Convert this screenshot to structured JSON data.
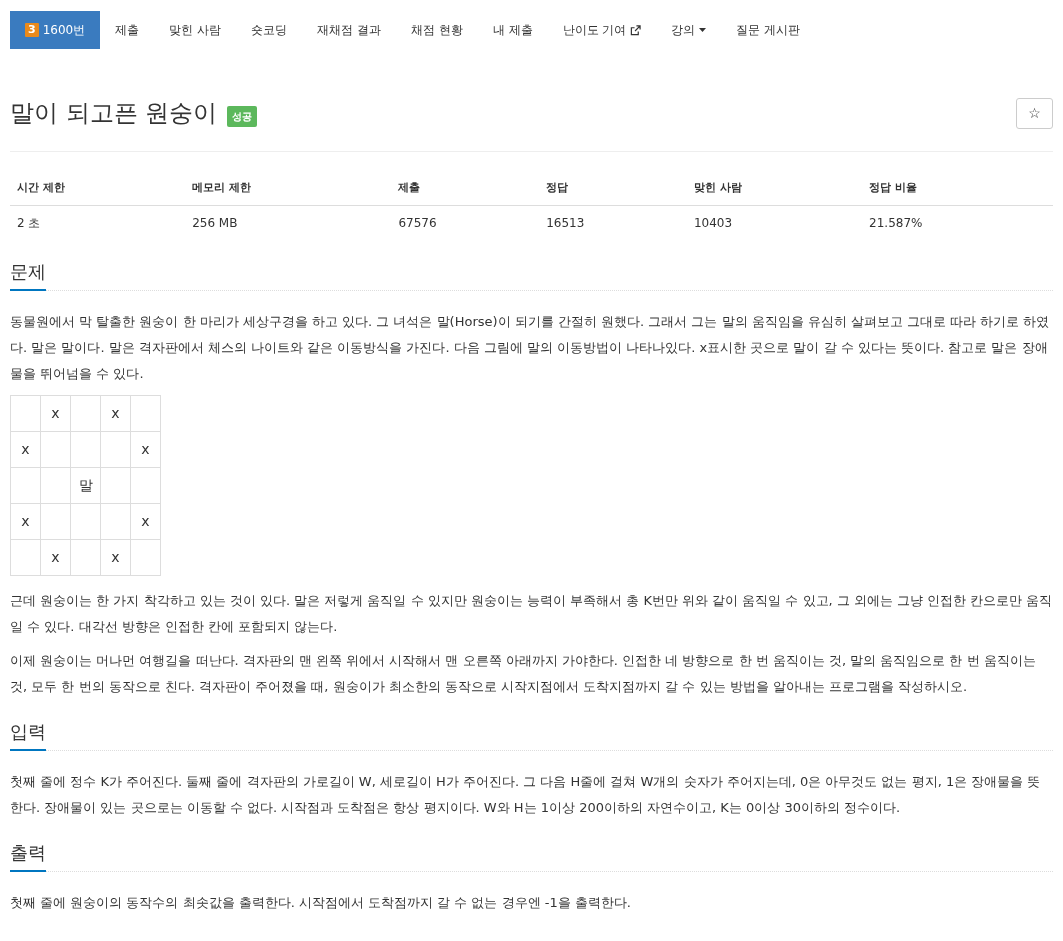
{
  "nav": [
    {
      "label": "1600번",
      "badge": "3",
      "kind": "problem",
      "selected": true
    },
    {
      "label": "제출",
      "kind": "link",
      "selected": false
    },
    {
      "label": "맞힌 사람",
      "kind": "link",
      "selected": false
    },
    {
      "label": "숏코딩",
      "kind": "link",
      "selected": false
    },
    {
      "label": "재채점 결과",
      "kind": "link",
      "selected": false
    },
    {
      "label": "채점 현황",
      "kind": "link",
      "selected": false
    },
    {
      "label": "내 제출",
      "kind": "link",
      "selected": false
    },
    {
      "label": "난이도 기여",
      "kind": "external",
      "selected": false
    },
    {
      "label": "강의",
      "kind": "dropdown",
      "selected": false
    },
    {
      "label": "질문 게시판",
      "kind": "link",
      "selected": false
    }
  ],
  "title": "말이 되고픈 원숭이",
  "status_badge": "성공",
  "star_button": "☆",
  "stats": {
    "columns": [
      "시간 제한",
      "메모리 제한",
      "제출",
      "정답",
      "맞힌 사람",
      "정답 비율"
    ],
    "row": [
      "2 초",
      "256 MB",
      "67576",
      "16513",
      "10403",
      "21.587%"
    ]
  },
  "sections": [
    {
      "heading": "문제",
      "blocks": [
        {
          "kind": "paragraph",
          "text": "동물원에서 막 탈출한 원숭이 한 마리가 세상구경을 하고 있다. 그 녀석은 말(Horse)이 되기를 간절히 원했다. 그래서 그는 말의 움직임을 유심히 살펴보고 그대로 따라 하기로 하였다. 말은 말이다. 말은 격자판에서 체스의 나이트와 같은 이동방식을 가진다. 다음 그림에 말의 이동방법이 나타나있다. x표시한 곳으로 말이 갈 수 있다는 뜻이다. 참고로 말은 장애물을 뛰어넘을 수 있다."
        },
        {
          "kind": "grid",
          "rows": [
            [
              null,
              "x",
              null,
              "x",
              null
            ],
            [
              "x",
              null,
              null,
              null,
              "x"
            ],
            [
              null,
              null,
              "말",
              null,
              null
            ],
            [
              "x",
              null,
              null,
              null,
              "x"
            ],
            [
              null,
              "x",
              null,
              "x",
              null
            ]
          ]
        },
        {
          "kind": "paragraph",
          "text": "근데 원숭이는 한 가지 착각하고 있는 것이 있다. 말은 저렇게 움직일 수 있지만 원숭이는 능력이 부족해서 총 K번만 위와 같이 움직일 수 있고, 그 외에는 그냥 인접한 칸으로만 움직일 수 있다. 대각선 방향은 인접한 칸에 포함되지 않는다."
        },
        {
          "kind": "paragraph",
          "text": "이제 원숭이는 머나먼 여행길을 떠난다. 격자판의 맨 왼쪽 위에서 시작해서 맨 오른쪽 아래까지 가야한다. 인접한 네 방향으로 한 번 움직이는 것, 말의 움직임으로 한 번 움직이는 것, 모두 한 번의 동작으로 친다. 격자판이 주어졌을 때, 원숭이가 최소한의 동작으로 시작지점에서 도착지점까지 갈 수 있는 방법을 알아내는 프로그램을 작성하시오."
        }
      ]
    },
    {
      "heading": "입력",
      "blocks": [
        {
          "kind": "paragraph",
          "text": "첫째 줄에 정수 K가 주어진다. 둘째 줄에 격자판의 가로길이 W, 세로길이 H가 주어진다. 그 다음 H줄에 걸쳐 W개의 숫자가 주어지는데, 0은 아무것도 없는 평지, 1은 장애물을 뜻한다. 장애물이 있는 곳으로는 이동할 수 없다. 시작점과 도착점은 항상 평지이다. W와 H는 1이상 200이하의 자연수이고, K는 0이상 30이하의 정수이다."
        }
      ]
    },
    {
      "heading": "출력",
      "blocks": [
        {
          "kind": "paragraph",
          "text": "첫째 줄에 원숭이의 동작수의 최솟값을 출력한다. 시작점에서 도착점까지 갈 수 없는 경우엔 -1을 출력한다."
        }
      ]
    }
  ]
}
